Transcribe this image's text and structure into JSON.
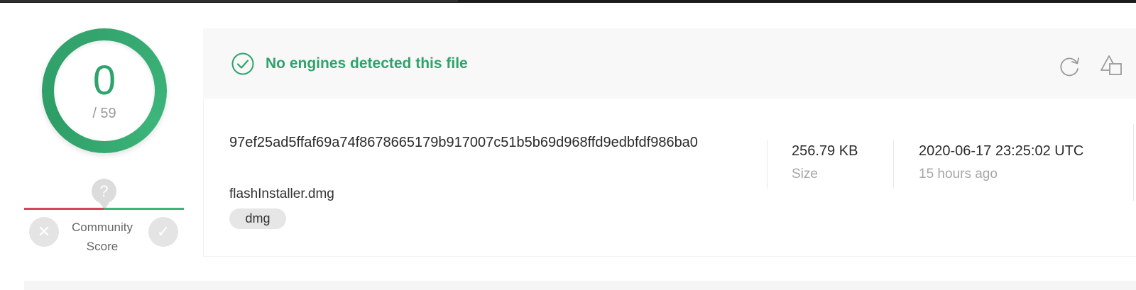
{
  "detection": {
    "score": "0",
    "total": "/ 59",
    "status_text": "No engines detected this file",
    "status_color": "#2ea36c"
  },
  "community": {
    "label": "Community Score",
    "bubble_glyph": "?",
    "downvote_glyph": "✕",
    "upvote_glyph": "✓",
    "negative_color": "#d6455d",
    "positive_color": "#3db57a"
  },
  "file": {
    "hash": "97ef25ad5ffaf69a74f8678665179b917007c51b5b69d968ffd9edbfdf986ba0",
    "name": "flashInstaller.dmg",
    "tag": "dmg",
    "size_value": "256.79 KB",
    "size_label": "Size",
    "date_value": "2020-06-17 23:25:02 UTC",
    "date_relative": "15 hours ago"
  },
  "icons": {
    "status": "check-circle-icon",
    "reanalyze": "reanalyze-icon",
    "graph": "graph-icon"
  }
}
